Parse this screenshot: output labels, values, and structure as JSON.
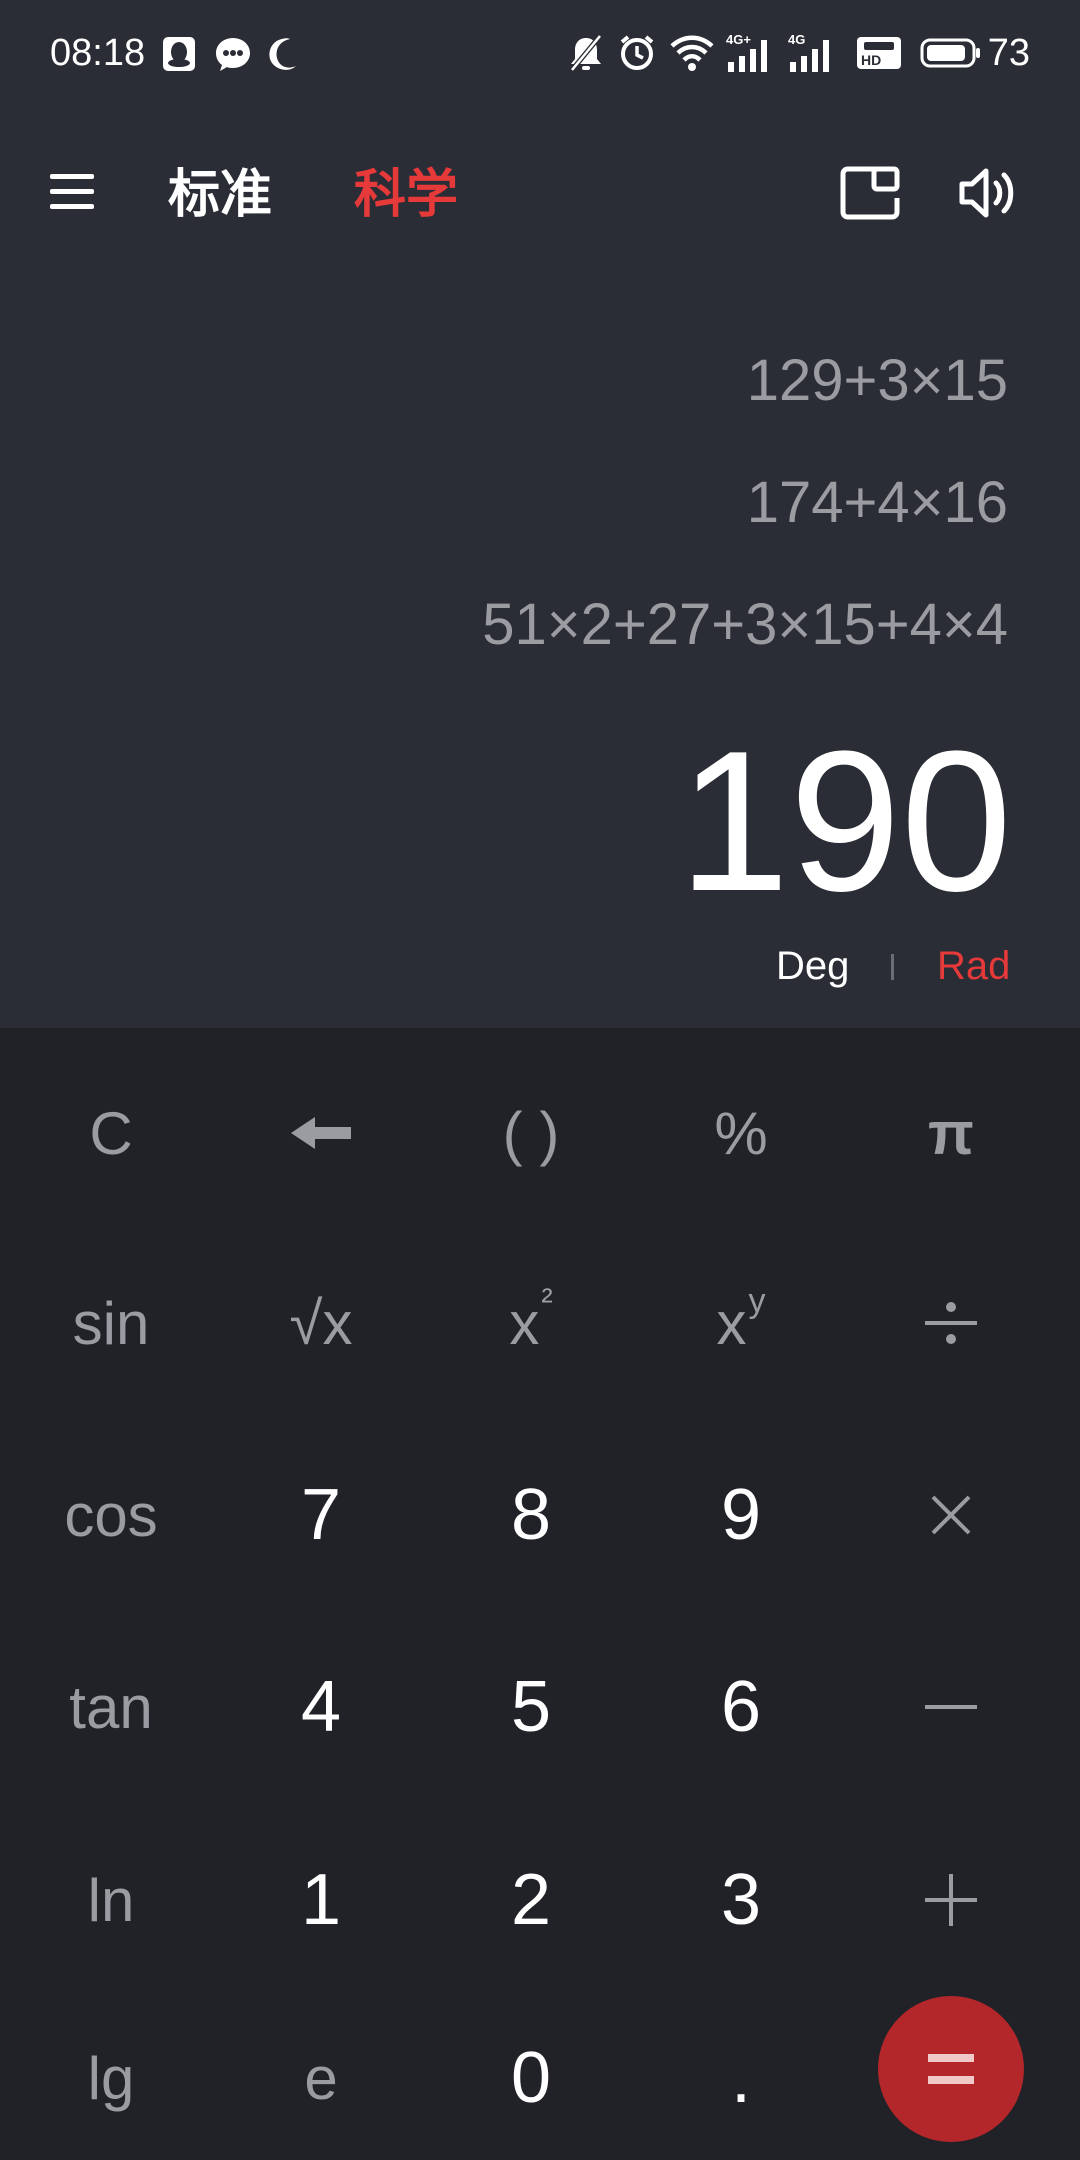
{
  "status_bar": {
    "time": "08:18",
    "battery_level": "73",
    "icons": [
      "qq-icon",
      "message-icon",
      "moon-icon",
      "mute-icon",
      "alarm-icon",
      "wifi-icon",
      "signal-4g-plus-icon",
      "signal-4g-icon",
      "hd-icon",
      "battery-icon"
    ]
  },
  "app_bar": {
    "menu_icon": "hamburger-menu-icon",
    "tab_standard": "标准",
    "tab_science": "科学",
    "float_window_icon": "floating-window-icon",
    "sound_icon": "speaker-icon"
  },
  "display": {
    "history": [
      "129+3×15",
      "174+4×16",
      "51×2+27+3×15+4×4"
    ],
    "result": "190",
    "angle_deg": "Deg",
    "angle_rad": "Rad"
  },
  "keypad": {
    "row1": [
      "C",
      "backspace",
      "( )",
      "%",
      "π"
    ],
    "row2": [
      "sin",
      "√x",
      "x²",
      "xʸ",
      "÷"
    ],
    "row3": [
      "cos",
      "7",
      "8",
      "9",
      "×"
    ],
    "row4": [
      "tan",
      "4",
      "5",
      "6",
      "−"
    ],
    "row5": [
      "ln",
      "1",
      "2",
      "3",
      "+"
    ],
    "row6": [
      "lg",
      "e",
      "0",
      ".",
      "="
    ],
    "labels": {
      "clear": "C",
      "paren": "( )",
      "percent": "%",
      "pi": "π",
      "sin": "sin",
      "sqrt": "√x",
      "square_base": "x",
      "square_exp": "²",
      "power_base": "x",
      "power_exp": "y",
      "cos": "cos",
      "tan": "tan",
      "ln": "ln",
      "lg": "lg",
      "e": "e",
      "n0": "0",
      "n1": "1",
      "n2": "2",
      "n3": "3",
      "n4": "4",
      "n5": "5",
      "n6": "6",
      "n7": "7",
      "n8": "8",
      "n9": "9",
      "dot": "."
    }
  },
  "colors": {
    "accent": "#e5393a",
    "equals_button": "#b3272a",
    "display_bg": "#2a2d35",
    "keypad_bg": "#202228",
    "function_text": "#9a9ca2",
    "number_text": "#ffffff"
  }
}
